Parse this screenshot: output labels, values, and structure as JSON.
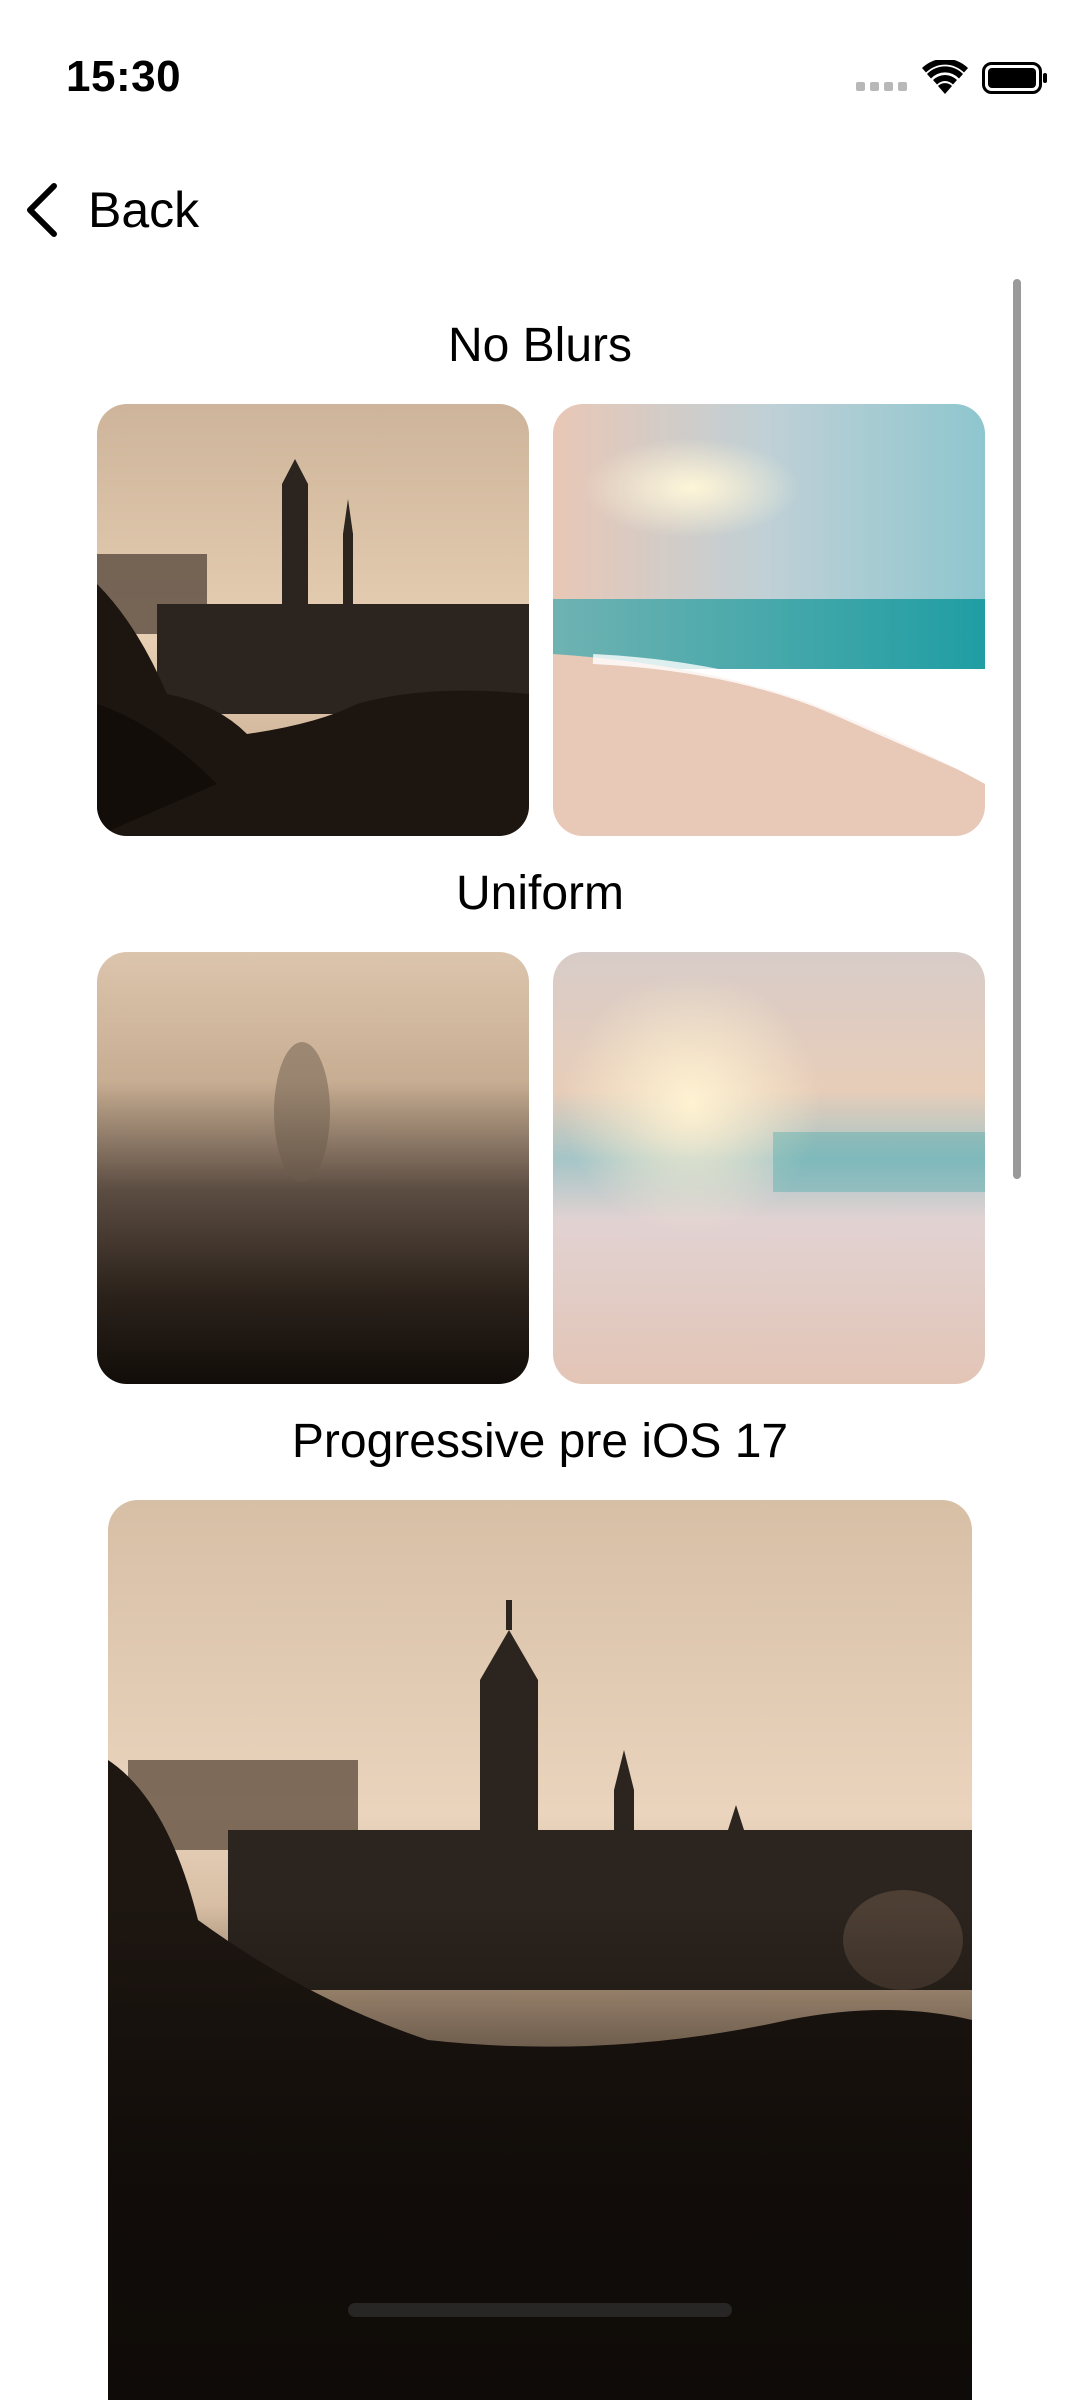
{
  "status": {
    "time": "15:30"
  },
  "nav": {
    "back_label": "Back"
  },
  "sections": {
    "no_blurs": "No Blurs",
    "uniform": "Uniform",
    "progressive": "Progressive pre iOS 17"
  },
  "icons": {
    "back": "chevron-left-icon",
    "wifi": "wifi-icon",
    "battery": "battery-icon",
    "signal": "cellular-signal-icon"
  }
}
